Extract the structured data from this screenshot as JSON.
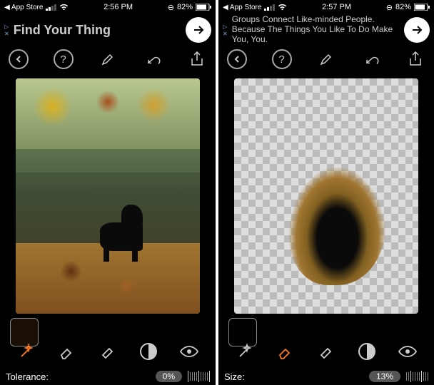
{
  "screens": [
    {
      "statusbar": {
        "back_app": "App Store",
        "time": "2:56 PM",
        "battery": "82%"
      },
      "ad": {
        "text": "Find Your Thing",
        "style": "large"
      },
      "canvas": {
        "mode": "original"
      },
      "swatch": "#1a0f05",
      "tools": {
        "active": "wand"
      },
      "slider": {
        "label": "Tolerance:",
        "value": "0%"
      }
    },
    {
      "statusbar": {
        "back_app": "App Store",
        "time": "2:57 PM",
        "battery": "82%"
      },
      "ad": {
        "text": "Groups Connect Like-minded People. Because The Things You Like To Do Make You, You.",
        "style": "small"
      },
      "canvas": {
        "mode": "cutout"
      },
      "swatch": "#000000",
      "tools": {
        "active": "erase"
      },
      "slider": {
        "label": "Size:",
        "value": "13%"
      }
    }
  ]
}
